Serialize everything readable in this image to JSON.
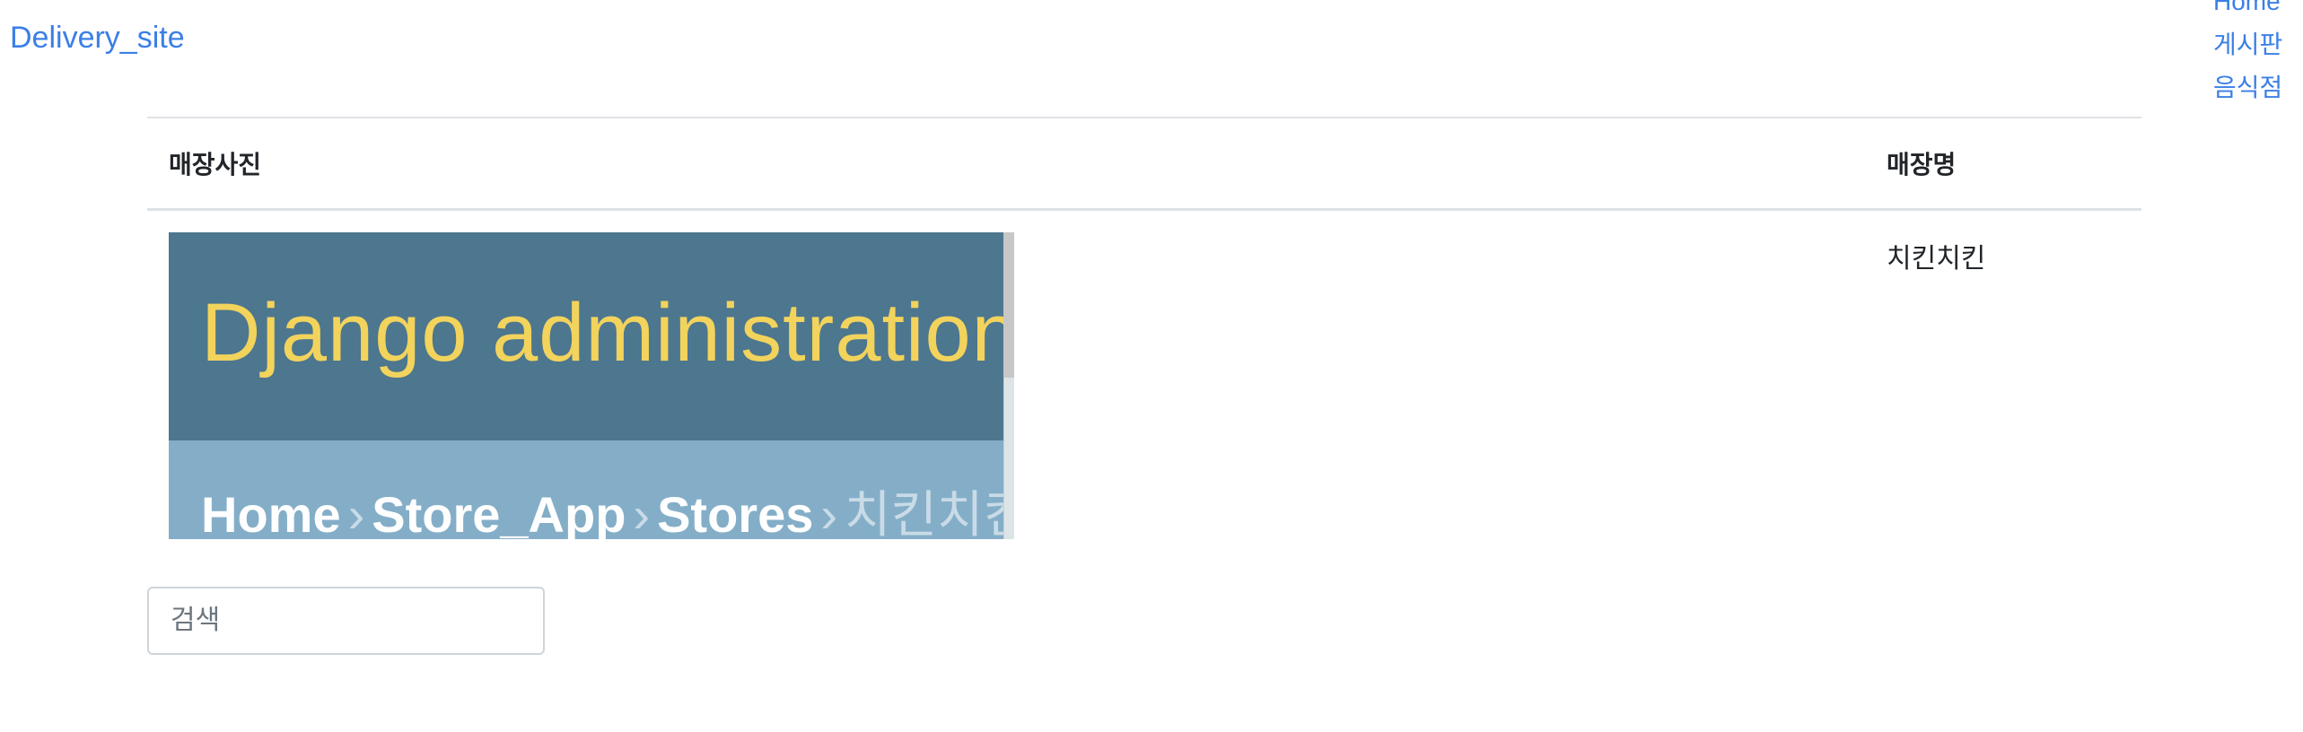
{
  "navbar": {
    "brand": "Delivery_site",
    "links": [
      "Home",
      "게시판",
      "음식점"
    ]
  },
  "table": {
    "headers": {
      "photo": "매장사진",
      "name": "매장명"
    },
    "rows": [
      {
        "store_name": "치킨치킨",
        "photo": {
          "header_title": "Django administration",
          "breadcrumbs": [
            "Home",
            "Store_App",
            "Stores",
            "치킨치킨"
          ],
          "separator": "›"
        }
      }
    ]
  },
  "search": {
    "placeholder": "검색"
  },
  "colors": {
    "link": "#3b7fe6",
    "admin_header": "#4d768f",
    "admin_title": "#f2d35c",
    "admin_breadcrumbs": "#84aec8"
  }
}
